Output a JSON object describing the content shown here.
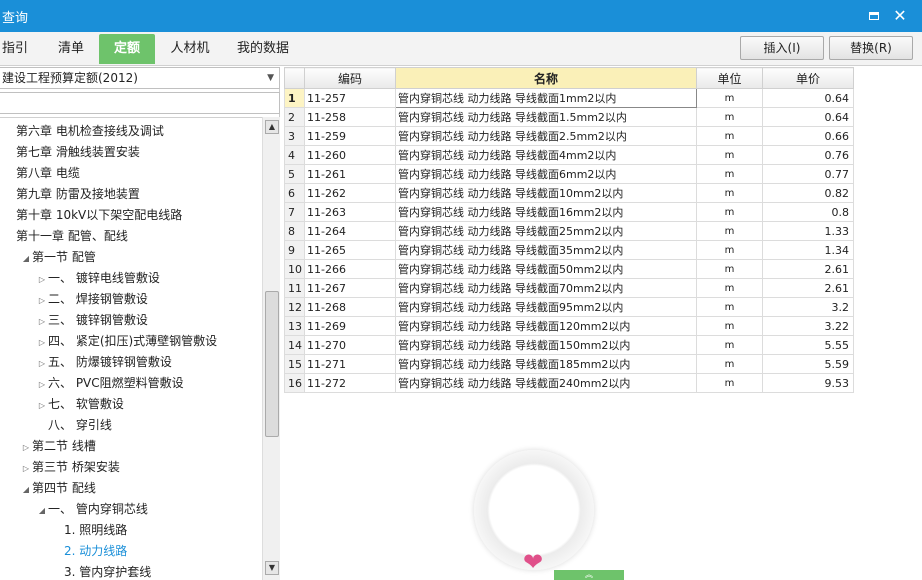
{
  "window": {
    "title": "查询"
  },
  "tabs": [
    {
      "label": "指引"
    },
    {
      "label": "清单"
    },
    {
      "label": "定额",
      "active": true
    },
    {
      "label": "人材机"
    },
    {
      "label": "我的数据"
    }
  ],
  "toolbar": {
    "insert_label": "插入(I)",
    "replace_label": "替换(R)"
  },
  "left_panel": {
    "quota_selector": "建设工程预算定额(2012)",
    "search": {
      "value": "",
      "placeholder": ""
    },
    "tree": [
      {
        "label": "第六章 电机检查接线及调试",
        "level": 0,
        "toggle": ""
      },
      {
        "label": "第七章 滑触线装置安装",
        "level": 0,
        "toggle": ""
      },
      {
        "label": "第八章 电缆",
        "level": 0,
        "toggle": ""
      },
      {
        "label": "第九章 防雷及接地装置",
        "level": 0,
        "toggle": ""
      },
      {
        "label": "第十章 10kV以下架空配电线路",
        "level": 0,
        "toggle": ""
      },
      {
        "label": "第十一章 配管、配线",
        "level": 0,
        "toggle": ""
      },
      {
        "label": "第一节 配管",
        "level": 1,
        "toggle": "expanded"
      },
      {
        "label": "一、 镀锌电线管敷设",
        "level": 2,
        "toggle": "collapsed"
      },
      {
        "label": "二、 焊接钢管敷设",
        "level": 2,
        "toggle": "collapsed"
      },
      {
        "label": "三、 镀锌钢管敷设",
        "level": 2,
        "toggle": "collapsed"
      },
      {
        "label": "四、 紧定(扣压)式薄壁钢管敷设",
        "level": 2,
        "toggle": "collapsed"
      },
      {
        "label": "五、 防爆镀锌钢管敷设",
        "level": 2,
        "toggle": "collapsed"
      },
      {
        "label": "六、 PVC阻燃塑料管敷设",
        "level": 2,
        "toggle": "collapsed"
      },
      {
        "label": "七、 软管敷设",
        "level": 2,
        "toggle": "collapsed"
      },
      {
        "label": "八、 穿引线",
        "level": 2,
        "toggle": ""
      },
      {
        "label": "第二节 线槽",
        "level": 1,
        "toggle": "collapsed"
      },
      {
        "label": "第三节 桥架安装",
        "level": 1,
        "toggle": "collapsed"
      },
      {
        "label": "第四节 配线",
        "level": 1,
        "toggle": "expanded"
      },
      {
        "label": "一、 管内穿铜芯线",
        "level": 2,
        "toggle": "expanded"
      },
      {
        "label": "1. 照明线路",
        "level": 3,
        "toggle": ""
      },
      {
        "label": "2. 动力线路",
        "level": 3,
        "toggle": "",
        "selected": true
      },
      {
        "label": "3. 管内穿护套线",
        "level": 3,
        "toggle": ""
      }
    ]
  },
  "table": {
    "columns": [
      "编码",
      "名称",
      "单位",
      "单价"
    ],
    "rows": [
      {
        "n": "1",
        "code": "11-257",
        "name": "管内穿铜芯线 动力线路 导线截面1mm2以内",
        "unit": "m",
        "price": "0.64"
      },
      {
        "n": "2",
        "code": "11-258",
        "name": "管内穿铜芯线 动力线路 导线截面1.5mm2以内",
        "unit": "m",
        "price": "0.64"
      },
      {
        "n": "3",
        "code": "11-259",
        "name": "管内穿铜芯线 动力线路 导线截面2.5mm2以内",
        "unit": "m",
        "price": "0.66"
      },
      {
        "n": "4",
        "code": "11-260",
        "name": "管内穿铜芯线 动力线路 导线截面4mm2以内",
        "unit": "m",
        "price": "0.76"
      },
      {
        "n": "5",
        "code": "11-261",
        "name": "管内穿铜芯线 动力线路 导线截面6mm2以内",
        "unit": "m",
        "price": "0.77"
      },
      {
        "n": "6",
        "code": "11-262",
        "name": "管内穿铜芯线 动力线路 导线截面10mm2以内",
        "unit": "m",
        "price": "0.82"
      },
      {
        "n": "7",
        "code": "11-263",
        "name": "管内穿铜芯线 动力线路 导线截面16mm2以内",
        "unit": "m",
        "price": "0.8"
      },
      {
        "n": "8",
        "code": "11-264",
        "name": "管内穿铜芯线 动力线路 导线截面25mm2以内",
        "unit": "m",
        "price": "1.33"
      },
      {
        "n": "9",
        "code": "11-265",
        "name": "管内穿铜芯线 动力线路 导线截面35mm2以内",
        "unit": "m",
        "price": "1.34"
      },
      {
        "n": "10",
        "code": "11-266",
        "name": "管内穿铜芯线 动力线路 导线截面50mm2以内",
        "unit": "m",
        "price": "2.61"
      },
      {
        "n": "11",
        "code": "11-267",
        "name": "管内穿铜芯线 动力线路 导线截面70mm2以内",
        "unit": "m",
        "price": "2.61"
      },
      {
        "n": "12",
        "code": "11-268",
        "name": "管内穿铜芯线 动力线路 导线截面95mm2以内",
        "unit": "m",
        "price": "3.2"
      },
      {
        "n": "13",
        "code": "11-269",
        "name": "管内穿铜芯线 动力线路 导线截面120mm2以内",
        "unit": "m",
        "price": "3.22"
      },
      {
        "n": "14",
        "code": "11-270",
        "name": "管内穿铜芯线 动力线路 导线截面150mm2以内",
        "unit": "m",
        "price": "5.55"
      },
      {
        "n": "15",
        "code": "11-271",
        "name": "管内穿铜芯线 动力线路 导线截面185mm2以内",
        "unit": "m",
        "price": "5.59"
      },
      {
        "n": "16",
        "code": "11-272",
        "name": "管内穿铜芯线 动力线路 导线截面240mm2以内",
        "unit": "m",
        "price": "9.53"
      }
    ]
  },
  "colors": {
    "titlebar": "#1a8fd8",
    "active_tab": "#6ec36b",
    "selected_tree_item": "#1a8fd8",
    "name_header": "#faf0b8"
  },
  "icons": {
    "minimize": "minimize-icon",
    "close": "close-icon",
    "heart": "heart-icon",
    "expand": "triangle-expanded-icon",
    "collapse": "triangle-collapsed-icon"
  }
}
